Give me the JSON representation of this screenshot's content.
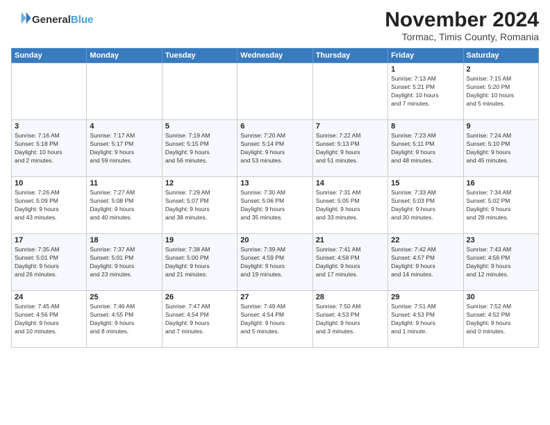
{
  "header": {
    "logo_line1": "General",
    "logo_line2": "Blue",
    "month": "November 2024",
    "location": "Tormac, Timis County, Romania"
  },
  "weekdays": [
    "Sunday",
    "Monday",
    "Tuesday",
    "Wednesday",
    "Thursday",
    "Friday",
    "Saturday"
  ],
  "weeks": [
    [
      {
        "day": "",
        "info": ""
      },
      {
        "day": "",
        "info": ""
      },
      {
        "day": "",
        "info": ""
      },
      {
        "day": "",
        "info": ""
      },
      {
        "day": "",
        "info": ""
      },
      {
        "day": "1",
        "info": "Sunrise: 7:13 AM\nSunset: 5:21 PM\nDaylight: 10 hours\nand 7 minutes."
      },
      {
        "day": "2",
        "info": "Sunrise: 7:15 AM\nSunset: 5:20 PM\nDaylight: 10 hours\nand 5 minutes."
      }
    ],
    [
      {
        "day": "3",
        "info": "Sunrise: 7:16 AM\nSunset: 5:18 PM\nDaylight: 10 hours\nand 2 minutes."
      },
      {
        "day": "4",
        "info": "Sunrise: 7:17 AM\nSunset: 5:17 PM\nDaylight: 9 hours\nand 59 minutes."
      },
      {
        "day": "5",
        "info": "Sunrise: 7:19 AM\nSunset: 5:15 PM\nDaylight: 9 hours\nand 56 minutes."
      },
      {
        "day": "6",
        "info": "Sunrise: 7:20 AM\nSunset: 5:14 PM\nDaylight: 9 hours\nand 53 minutes."
      },
      {
        "day": "7",
        "info": "Sunrise: 7:22 AM\nSunset: 5:13 PM\nDaylight: 9 hours\nand 51 minutes."
      },
      {
        "day": "8",
        "info": "Sunrise: 7:23 AM\nSunset: 5:11 PM\nDaylight: 9 hours\nand 48 minutes."
      },
      {
        "day": "9",
        "info": "Sunrise: 7:24 AM\nSunset: 5:10 PM\nDaylight: 9 hours\nand 45 minutes."
      }
    ],
    [
      {
        "day": "10",
        "info": "Sunrise: 7:26 AM\nSunset: 5:09 PM\nDaylight: 9 hours\nand 43 minutes."
      },
      {
        "day": "11",
        "info": "Sunrise: 7:27 AM\nSunset: 5:08 PM\nDaylight: 9 hours\nand 40 minutes."
      },
      {
        "day": "12",
        "info": "Sunrise: 7:29 AM\nSunset: 5:07 PM\nDaylight: 9 hours\nand 38 minutes."
      },
      {
        "day": "13",
        "info": "Sunrise: 7:30 AM\nSunset: 5:06 PM\nDaylight: 9 hours\nand 35 minutes."
      },
      {
        "day": "14",
        "info": "Sunrise: 7:31 AM\nSunset: 5:05 PM\nDaylight: 9 hours\nand 33 minutes."
      },
      {
        "day": "15",
        "info": "Sunrise: 7:33 AM\nSunset: 5:03 PM\nDaylight: 9 hours\nand 30 minutes."
      },
      {
        "day": "16",
        "info": "Sunrise: 7:34 AM\nSunset: 5:02 PM\nDaylight: 9 hours\nand 28 minutes."
      }
    ],
    [
      {
        "day": "17",
        "info": "Sunrise: 7:35 AM\nSunset: 5:01 PM\nDaylight: 9 hours\nand 26 minutes."
      },
      {
        "day": "18",
        "info": "Sunrise: 7:37 AM\nSunset: 5:01 PM\nDaylight: 9 hours\nand 23 minutes."
      },
      {
        "day": "19",
        "info": "Sunrise: 7:38 AM\nSunset: 5:00 PM\nDaylight: 9 hours\nand 21 minutes."
      },
      {
        "day": "20",
        "info": "Sunrise: 7:39 AM\nSunset: 4:59 PM\nDaylight: 9 hours\nand 19 minutes."
      },
      {
        "day": "21",
        "info": "Sunrise: 7:41 AM\nSunset: 4:58 PM\nDaylight: 9 hours\nand 17 minutes."
      },
      {
        "day": "22",
        "info": "Sunrise: 7:42 AM\nSunset: 4:57 PM\nDaylight: 9 hours\nand 14 minutes."
      },
      {
        "day": "23",
        "info": "Sunrise: 7:43 AM\nSunset: 4:56 PM\nDaylight: 9 hours\nand 12 minutes."
      }
    ],
    [
      {
        "day": "24",
        "info": "Sunrise: 7:45 AM\nSunset: 4:56 PM\nDaylight: 9 hours\nand 10 minutes."
      },
      {
        "day": "25",
        "info": "Sunrise: 7:46 AM\nSunset: 4:55 PM\nDaylight: 9 hours\nand 8 minutes."
      },
      {
        "day": "26",
        "info": "Sunrise: 7:47 AM\nSunset: 4:54 PM\nDaylight: 9 hours\nand 7 minutes."
      },
      {
        "day": "27",
        "info": "Sunrise: 7:49 AM\nSunset: 4:54 PM\nDaylight: 9 hours\nand 5 minutes."
      },
      {
        "day": "28",
        "info": "Sunrise: 7:50 AM\nSunset: 4:53 PM\nDaylight: 9 hours\nand 3 minutes."
      },
      {
        "day": "29",
        "info": "Sunrise: 7:51 AM\nSunset: 4:53 PM\nDaylight: 9 hours\nand 1 minute."
      },
      {
        "day": "30",
        "info": "Sunrise: 7:52 AM\nSunset: 4:52 PM\nDaylight: 9 hours\nand 0 minutes."
      }
    ]
  ]
}
